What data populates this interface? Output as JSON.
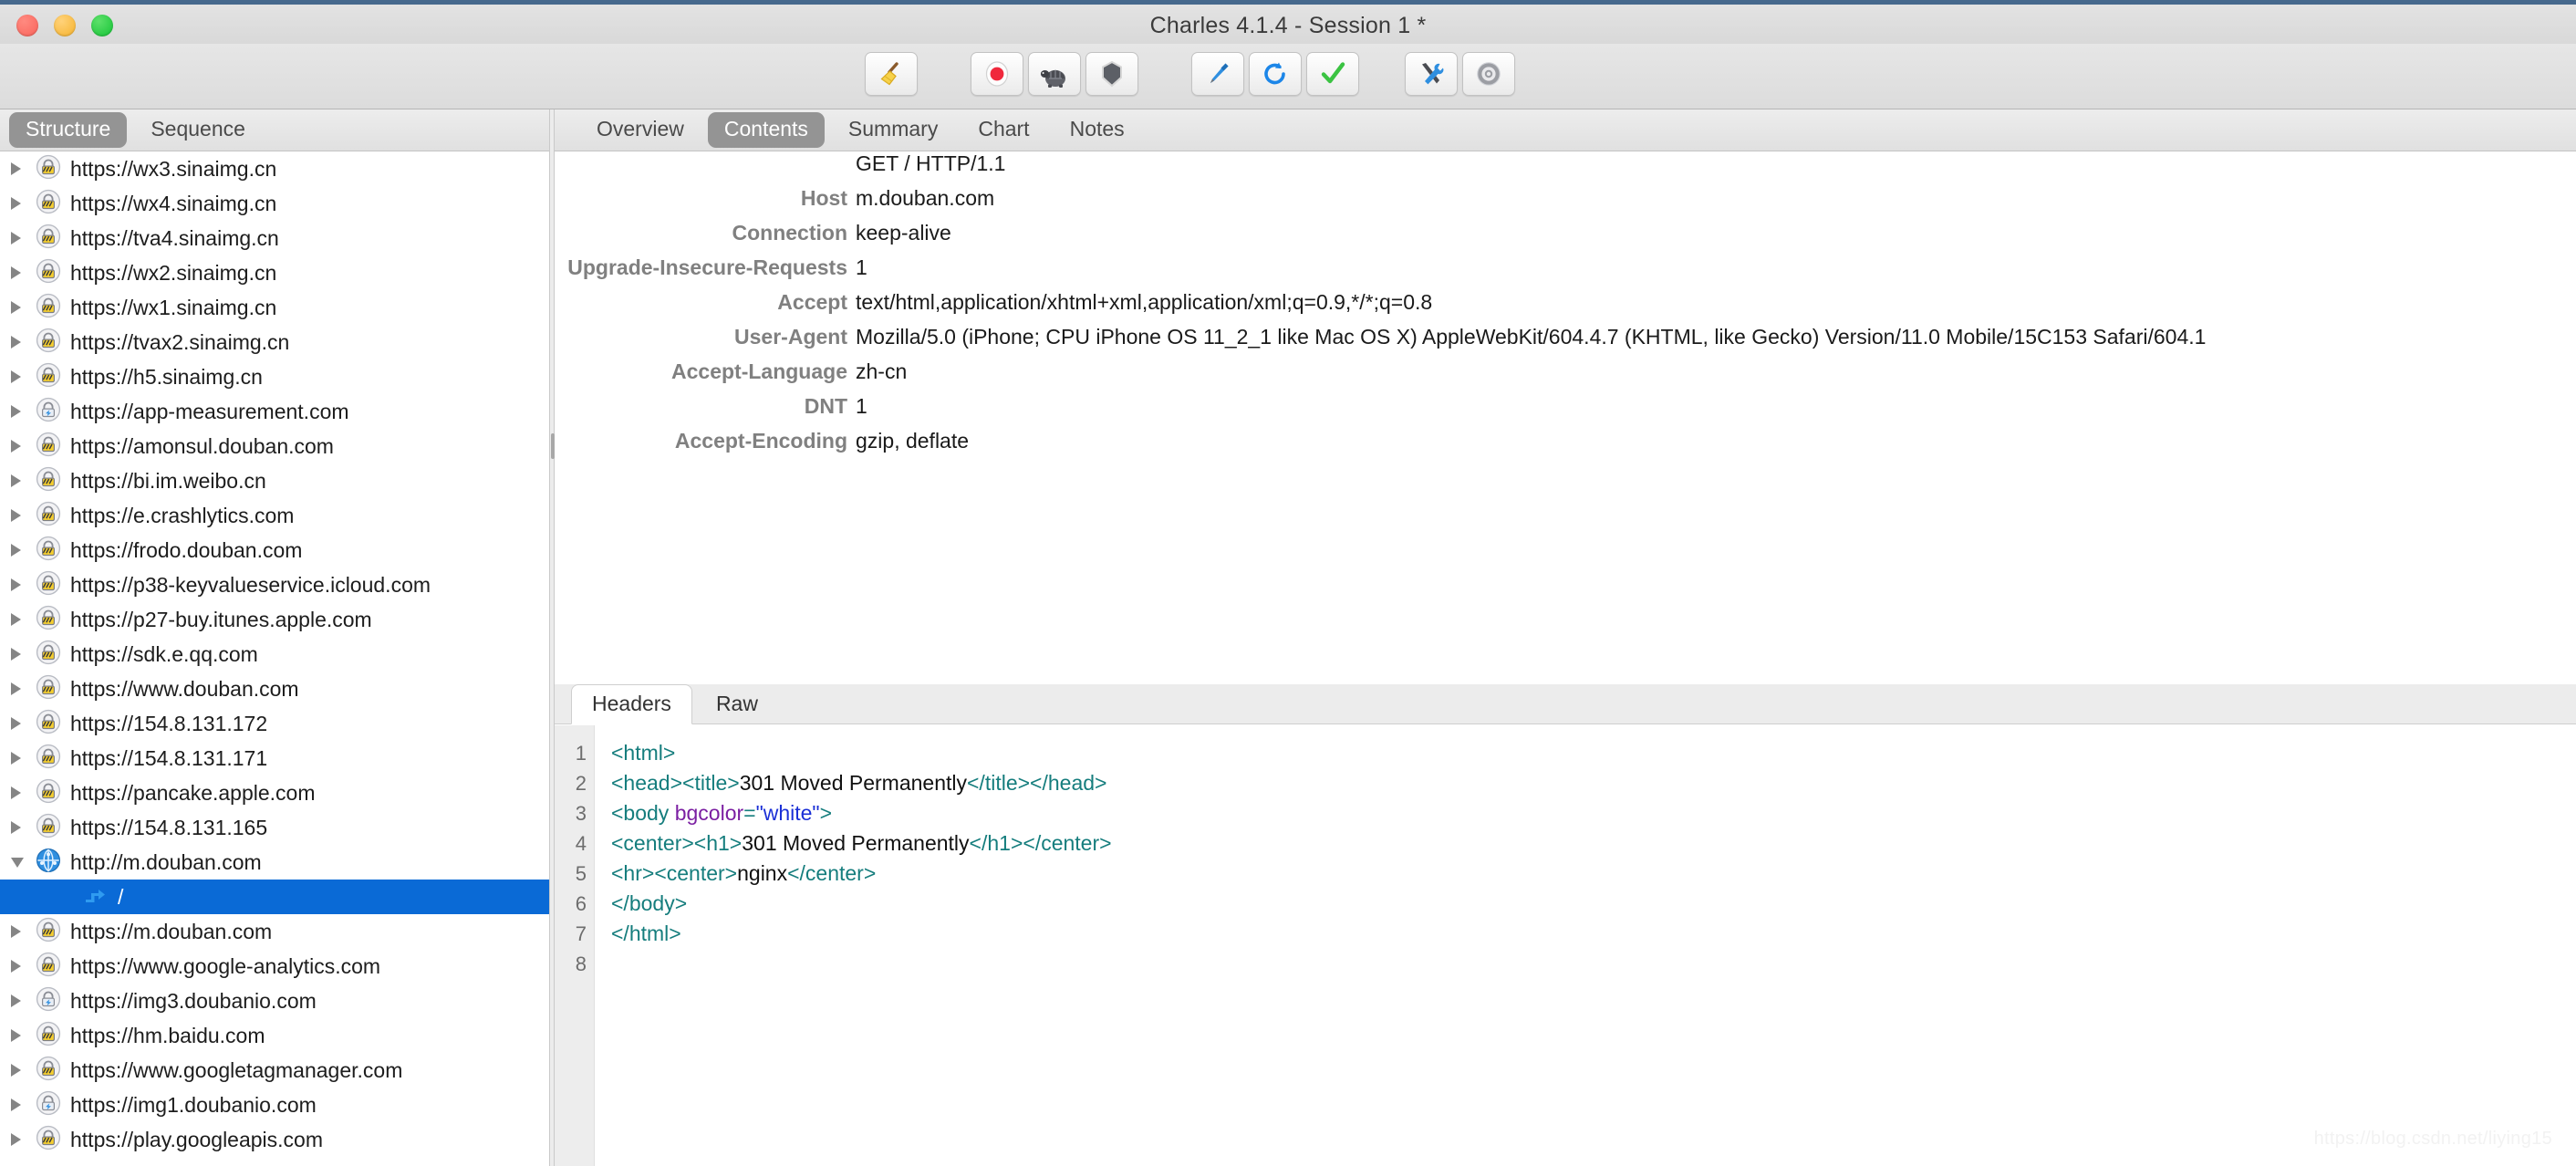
{
  "window": {
    "title": "Charles 4.1.4 - Session 1 *",
    "traffic_lights": [
      "close-button",
      "minimize-button",
      "zoom-button"
    ]
  },
  "toolbar": {
    "buttons": [
      {
        "name": "clear-session-button",
        "icon": "broom-icon",
        "label": "Clear"
      },
      {
        "name": "record-button",
        "icon": "record-icon",
        "label": "Start/Stop Recording"
      },
      {
        "name": "throttle-button",
        "icon": "turtle-icon",
        "label": "Throttle Settings"
      },
      {
        "name": "breakpoints-button",
        "icon": "shield-icon",
        "label": "Breakpoint Settings"
      },
      {
        "name": "compose-button",
        "icon": "pen-icon",
        "label": "Compose"
      },
      {
        "name": "repeat-button",
        "icon": "repeat-icon",
        "label": "Repeat"
      },
      {
        "name": "validate-button",
        "icon": "checkmark-icon",
        "label": "Validate"
      },
      {
        "name": "tools-button",
        "icon": "tools-icon",
        "label": "Tools"
      },
      {
        "name": "settings-button",
        "icon": "gear-icon",
        "label": "Settings"
      }
    ]
  },
  "left_pane": {
    "tabs": [
      {
        "label": "Structure",
        "active": true
      },
      {
        "label": "Sequence",
        "active": false
      }
    ],
    "tree": [
      {
        "label": "https://wx3.sinaimg.cn",
        "icon": "lock-icon",
        "expanded": false,
        "child": false,
        "selected": false
      },
      {
        "label": "https://wx4.sinaimg.cn",
        "icon": "lock-icon",
        "expanded": false,
        "child": false,
        "selected": false
      },
      {
        "label": "https://tva4.sinaimg.cn",
        "icon": "lock-icon",
        "expanded": false,
        "child": false,
        "selected": false
      },
      {
        "label": "https://wx2.sinaimg.cn",
        "icon": "lock-icon",
        "expanded": false,
        "child": false,
        "selected": false
      },
      {
        "label": "https://wx1.sinaimg.cn",
        "icon": "lock-icon",
        "expanded": false,
        "child": false,
        "selected": false
      },
      {
        "label": "https://tvax2.sinaimg.cn",
        "icon": "lock-icon",
        "expanded": false,
        "child": false,
        "selected": false
      },
      {
        "label": "https://h5.sinaimg.cn",
        "icon": "lock-icon",
        "expanded": false,
        "child": false,
        "selected": false
      },
      {
        "label": "https://app-measurement.com",
        "icon": "lock-bolt-icon",
        "expanded": false,
        "child": false,
        "selected": false
      },
      {
        "label": "https://amonsul.douban.com",
        "icon": "lock-icon",
        "expanded": false,
        "child": false,
        "selected": false
      },
      {
        "label": "https://bi.im.weibo.cn",
        "icon": "lock-icon",
        "expanded": false,
        "child": false,
        "selected": false
      },
      {
        "label": "https://e.crashlytics.com",
        "icon": "lock-icon",
        "expanded": false,
        "child": false,
        "selected": false
      },
      {
        "label": "https://frodo.douban.com",
        "icon": "lock-icon",
        "expanded": false,
        "child": false,
        "selected": false
      },
      {
        "label": "https://p38-keyvalueservice.icloud.com",
        "icon": "lock-icon",
        "expanded": false,
        "child": false,
        "selected": false
      },
      {
        "label": "https://p27-buy.itunes.apple.com",
        "icon": "lock-icon",
        "expanded": false,
        "child": false,
        "selected": false
      },
      {
        "label": "https://sdk.e.qq.com",
        "icon": "lock-icon",
        "expanded": false,
        "child": false,
        "selected": false
      },
      {
        "label": "https://www.douban.com",
        "icon": "lock-icon",
        "expanded": false,
        "child": false,
        "selected": false
      },
      {
        "label": "https://154.8.131.172",
        "icon": "lock-icon",
        "expanded": false,
        "child": false,
        "selected": false
      },
      {
        "label": "https://154.8.131.171",
        "icon": "lock-icon",
        "expanded": false,
        "child": false,
        "selected": false
      },
      {
        "label": "https://pancake.apple.com",
        "icon": "lock-icon",
        "expanded": false,
        "child": false,
        "selected": false
      },
      {
        "label": "https://154.8.131.165",
        "icon": "lock-icon",
        "expanded": false,
        "child": false,
        "selected": false
      },
      {
        "label": "http://m.douban.com",
        "icon": "globe-icon",
        "expanded": true,
        "child": false,
        "selected": false
      },
      {
        "label": "/",
        "icon": "redirect-arrow-icon",
        "expanded": false,
        "child": true,
        "selected": true
      },
      {
        "label": "https://m.douban.com",
        "icon": "lock-icon",
        "expanded": false,
        "child": false,
        "selected": false
      },
      {
        "label": "https://www.google-analytics.com",
        "icon": "lock-icon",
        "expanded": false,
        "child": false,
        "selected": false
      },
      {
        "label": "https://img3.doubanio.com",
        "icon": "lock-bolt-icon",
        "expanded": false,
        "child": false,
        "selected": false
      },
      {
        "label": "https://hm.baidu.com",
        "icon": "lock-icon",
        "expanded": false,
        "child": false,
        "selected": false
      },
      {
        "label": "https://www.googletagmanager.com",
        "icon": "lock-icon",
        "expanded": false,
        "child": false,
        "selected": false
      },
      {
        "label": "https://img1.doubanio.com",
        "icon": "lock-bolt-icon",
        "expanded": false,
        "child": false,
        "selected": false
      },
      {
        "label": "https://play.googleapis.com",
        "icon": "lock-icon",
        "expanded": false,
        "child": false,
        "selected": false
      }
    ]
  },
  "right_pane": {
    "tabs": [
      {
        "label": "Overview",
        "active": false
      },
      {
        "label": "Contents",
        "active": true
      },
      {
        "label": "Summary",
        "active": false
      },
      {
        "label": "Chart",
        "active": false
      },
      {
        "label": "Notes",
        "active": false
      }
    ],
    "request_line": "GET / HTTP/1.1",
    "headers": [
      {
        "name": "Host",
        "value": "m.douban.com"
      },
      {
        "name": "Connection",
        "value": "keep-alive"
      },
      {
        "name": "Upgrade-Insecure-Requests",
        "value": "1"
      },
      {
        "name": "Accept",
        "value": "text/html,application/xhtml+xml,application/xml;q=0.9,*/*;q=0.8"
      },
      {
        "name": "User-Agent",
        "value": "Mozilla/5.0 (iPhone; CPU iPhone OS 11_2_1 like Mac OS X) AppleWebKit/604.4.7 (KHTML, like Gecko) Version/11.0 Mobile/15C153 Safari/604.1"
      },
      {
        "name": "Accept-Language",
        "value": "zh-cn"
      },
      {
        "name": "DNT",
        "value": "1"
      },
      {
        "name": "Accept-Encoding",
        "value": "gzip, deflate"
      }
    ],
    "body_tabs": [
      {
        "label": "Headers",
        "active": true
      },
      {
        "label": "Raw",
        "active": false
      }
    ],
    "line_numbers": [
      "1",
      "2",
      "3",
      "4",
      "5",
      "6",
      "7",
      "8"
    ],
    "code_lines": [
      [
        {
          "t": "tag",
          "s": "<html>"
        }
      ],
      [
        {
          "t": "tag",
          "s": "<head><title>"
        },
        {
          "t": "text",
          "s": "301 Moved Permanently"
        },
        {
          "t": "tag",
          "s": "</title></head>"
        }
      ],
      [
        {
          "t": "tag",
          "s": "<body "
        },
        {
          "t": "attr",
          "s": "bgcolor"
        },
        {
          "t": "tag",
          "s": "="
        },
        {
          "t": "str",
          "s": "\"white\""
        },
        {
          "t": "tag",
          "s": ">"
        }
      ],
      [
        {
          "t": "tag",
          "s": "<center><h1>"
        },
        {
          "t": "text",
          "s": "301 Moved Permanently"
        },
        {
          "t": "tag",
          "s": "</h1></center>"
        }
      ],
      [
        {
          "t": "tag",
          "s": "<hr><center>"
        },
        {
          "t": "text",
          "s": "nginx"
        },
        {
          "t": "tag",
          "s": "</center>"
        }
      ],
      [
        {
          "t": "tag",
          "s": "</body>"
        }
      ],
      [
        {
          "t": "tag",
          "s": "</html>"
        }
      ],
      []
    ]
  },
  "watermark": "https://blog.csdn.net/liying15",
  "colors": {
    "selection_blue": "#0a6ad6",
    "tab_active_gray": "#949494",
    "title_bar_top": "#46698d",
    "code_tag": "#157d7d",
    "code_attr": "#7b1fa2",
    "code_string": "#1a2fd6"
  }
}
